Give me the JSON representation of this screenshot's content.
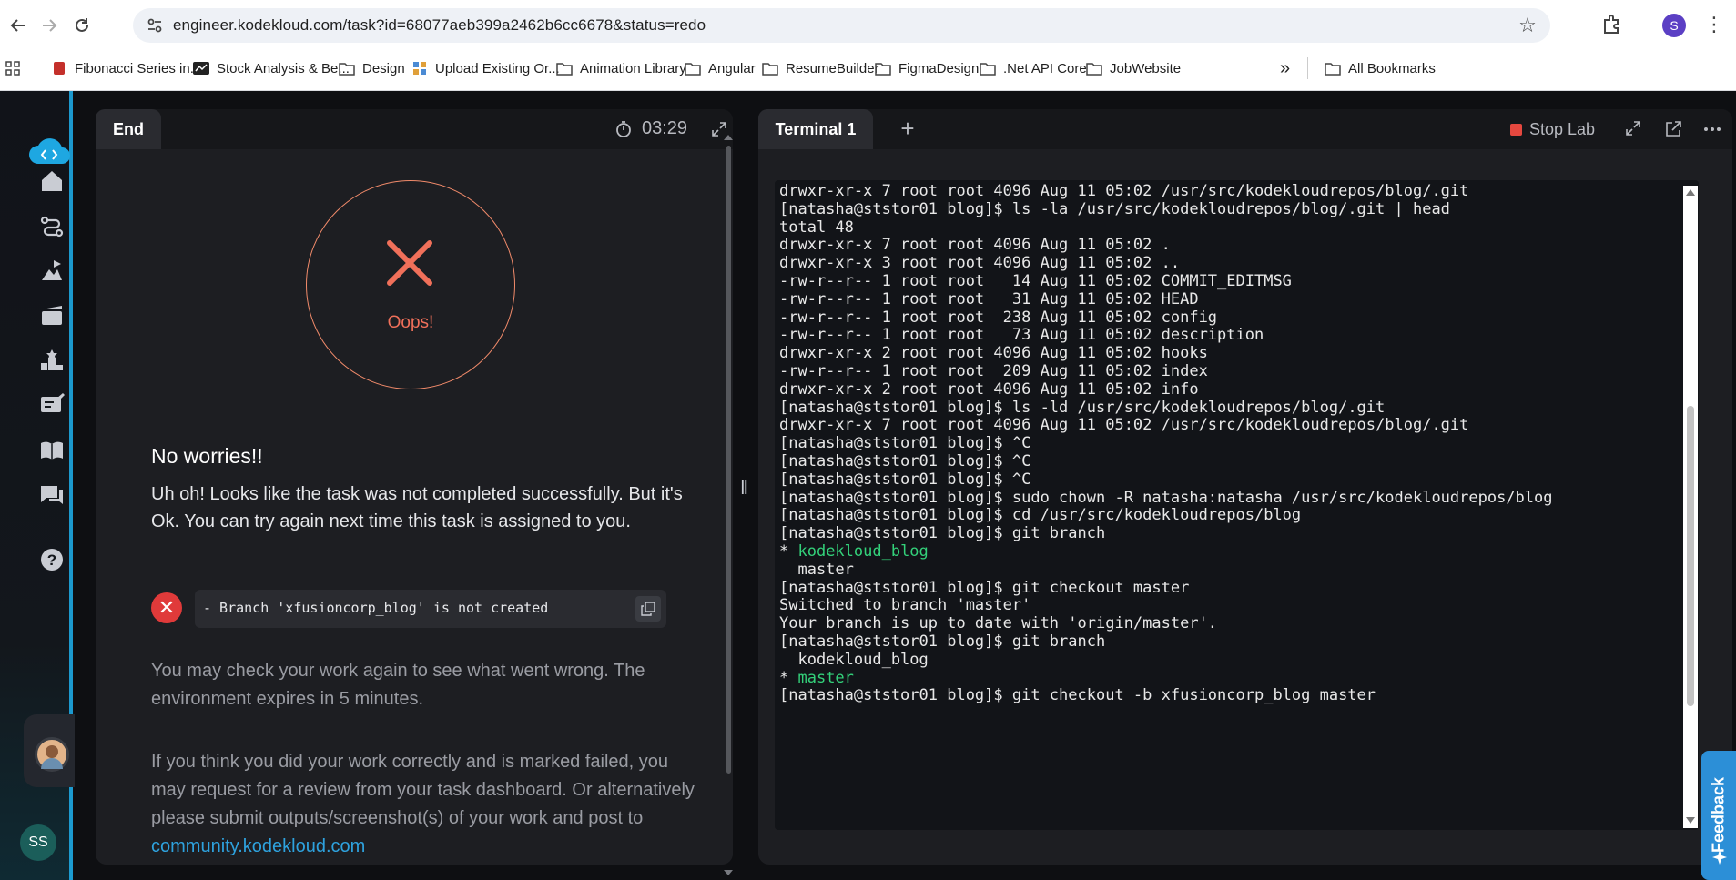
{
  "browser": {
    "url": "engineer.kodekloud.com/task?id=68077aeb399a2462b6cc6678&status=redo",
    "profile_initial": "S",
    "bookmarks": [
      {
        "label": "Fibonacci Series in...",
        "icon": "youtube-icon"
      },
      {
        "label": "Stock Analysis & Be...",
        "icon": "site-icon"
      },
      {
        "label": "Design",
        "icon": "folder-icon"
      },
      {
        "label": "Upload Existing Or...",
        "icon": "site-icon"
      },
      {
        "label": "Animation Library",
        "icon": "folder-icon"
      },
      {
        "label": "Angular",
        "icon": "folder-icon"
      },
      {
        "label": "ResumeBuilder",
        "icon": "folder-icon"
      },
      {
        "label": "FigmaDesign",
        "icon": "folder-icon"
      },
      {
        "label": ".Net API Core",
        "icon": "folder-icon"
      },
      {
        "label": "JobWebsite",
        "icon": "folder-icon"
      }
    ],
    "overflow_label": "»",
    "all_bookmarks": "All Bookmarks"
  },
  "sidebar": {
    "items": [
      "home-icon",
      "roadmap-icon",
      "courses-icon",
      "labs-icon",
      "leaderboard-icon",
      "tasks-icon",
      "docs-icon",
      "chat-icon",
      "help-icon"
    ],
    "user_initials": "SS"
  },
  "left_panel": {
    "tab": "End",
    "timer": "03:29",
    "oops": "Oops!",
    "title": "No worries!!",
    "message": "Uh oh! Looks like the task was not completed successfully. But it's Ok. You can try again next time this task is assigned to you.",
    "error_text": "- Branch 'xfusioncorp_blog' is not created",
    "check_message": "You may check your work again to see what went wrong. The environment expires in 5 minutes.",
    "review_message": "If you think you did your work correctly and is marked failed, you may request for a review from your task dashboard. Or alternatively please submit outputs/screenshot(s) of your work and post to ",
    "community_link": "community.kodekloud.com"
  },
  "right_panel": {
    "tab": "Terminal 1",
    "add_tab": "+",
    "stop_lab": "Stop Lab",
    "feedback": "Feedback",
    "terminal_lines": [
      {
        "text": "drwxr-xr-x 7 root root 4096 Aug 11 05:02 /usr/src/kodekloudrepos/blog/.git"
      },
      {
        "text": "[natasha@ststor01 blog]$ ls -la /usr/src/kodekloudrepos/blog/.git | head"
      },
      {
        "text": "total 48"
      },
      {
        "text": "drwxr-xr-x 7 root root 4096 Aug 11 05:02 ."
      },
      {
        "text": "drwxr-xr-x 3 root root 4096 Aug 11 05:02 .."
      },
      {
        "text": "-rw-r--r-- 1 root root   14 Aug 11 05:02 COMMIT_EDITMSG"
      },
      {
        "text": "-rw-r--r-- 1 root root   31 Aug 11 05:02 HEAD"
      },
      {
        "text": "-rw-r--r-- 1 root root  238 Aug 11 05:02 config"
      },
      {
        "text": "-rw-r--r-- 1 root root   73 Aug 11 05:02 description"
      },
      {
        "text": "drwxr-xr-x 2 root root 4096 Aug 11 05:02 hooks"
      },
      {
        "text": "-rw-r--r-- 1 root root  209 Aug 11 05:02 index"
      },
      {
        "text": "drwxr-xr-x 2 root root 4096 Aug 11 05:02 info"
      },
      {
        "text": "[natasha@ststor01 blog]$ ls -ld /usr/src/kodekloudrepos/blog/.git"
      },
      {
        "text": "drwxr-xr-x 7 root root 4096 Aug 11 05:02 /usr/src/kodekloudrepos/blog/.git"
      },
      {
        "text": "[natasha@ststor01 blog]$ ^C"
      },
      {
        "text": "[natasha@ststor01 blog]$ ^C"
      },
      {
        "text": "[natasha@ststor01 blog]$ ^C"
      },
      {
        "text": "[natasha@ststor01 blog]$ sudo chown -R natasha:natasha /usr/src/kodekloudrepos/blog"
      },
      {
        "text": "[natasha@ststor01 blog]$ cd /usr/src/kodekloudrepos/blog"
      },
      {
        "text": "[natasha@ststor01 blog]$ git branch"
      },
      {
        "prefix": "* ",
        "text": "kodekloud_blog",
        "color": "green"
      },
      {
        "text": "  master"
      },
      {
        "text": "[natasha@ststor01 blog]$ git checkout master"
      },
      {
        "text": "Switched to branch 'master'"
      },
      {
        "text": "Your branch is up to date with 'origin/master'."
      },
      {
        "text": "[natasha@ststor01 blog]$ git branch"
      },
      {
        "text": "  kodekloud_blog"
      },
      {
        "prefix": "* ",
        "text": "master",
        "color": "green"
      },
      {
        "text": "[natasha@ststor01 blog]$ git checkout -b xfusioncorp_blog master"
      }
    ]
  },
  "colors": {
    "accent": "#1ea7e1",
    "error": "#e03a3a",
    "oops": "#f0705a",
    "link": "#2ea2de",
    "branch_current": "#33d17a",
    "stop": "#e5483f",
    "feedback": "#2c8fd7"
  }
}
